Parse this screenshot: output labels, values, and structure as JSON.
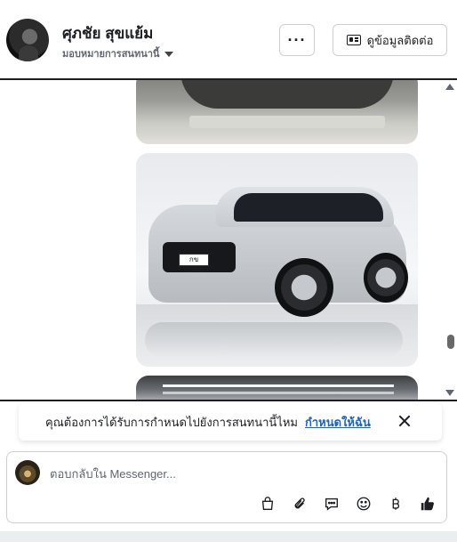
{
  "header": {
    "contact_name": "ศุภชัย สุขแย้ม",
    "assign_label": "มอบหมายการสนทนานี้",
    "more_label": "···",
    "contact_info_label": "ดูข้อมูลติดต่อ"
  },
  "messages": {
    "license_plate": "กข 2086",
    "scroll_position_fraction": 0.88
  },
  "banner": {
    "text": "คุณต้องการได้รับการกำหนดไปยังการสนทนานี้ไหม",
    "action_label": "กำหนดให้ฉัน"
  },
  "composer": {
    "placeholder": "ตอบกลับใน Messenger...",
    "tools": [
      "shopping-bag-icon",
      "paperclip-icon",
      "chat-bubble-icon",
      "emoji-icon",
      "baht-icon",
      "thumbs-up-icon"
    ]
  },
  "colors": {
    "link": "#1a63c9",
    "border": "#ccd0d5",
    "text": "#1c1e21",
    "muted": "#606770"
  }
}
